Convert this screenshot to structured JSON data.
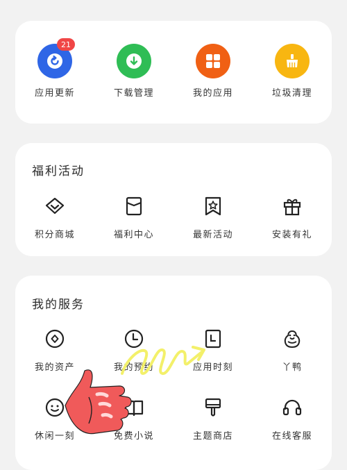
{
  "colors": {
    "background": "#f2f2f2",
    "card": "#ffffff",
    "update": "#2f66e6",
    "download": "#2fbd55",
    "my_apps": "#f06014",
    "cleanup": "#f8b611",
    "badge": "#f04646",
    "hand": "#f05a5a",
    "scribble": "#f3f06a"
  },
  "top": {
    "items": [
      {
        "label": "应用更新",
        "icon": "refresh-icon",
        "badge": "21"
      },
      {
        "label": "下载管理",
        "icon": "download-icon"
      },
      {
        "label": "我的应用",
        "icon": "apps-grid-icon"
      },
      {
        "label": "垃圾清理",
        "icon": "broom-icon"
      }
    ]
  },
  "welfare": {
    "title": "福利活动",
    "items": [
      {
        "label": "积分商城",
        "icon": "diamond-icon"
      },
      {
        "label": "福利中心",
        "icon": "envelope-icon"
      },
      {
        "label": "最新活动",
        "icon": "star-bookmark-icon"
      },
      {
        "label": "安装有礼",
        "icon": "gift-icon"
      }
    ]
  },
  "service": {
    "title": "我的服务",
    "rows": [
      [
        {
          "label": "我的资产",
          "icon": "coin-icon"
        },
        {
          "label": "我的预约",
          "icon": "clock-icon"
        },
        {
          "label": "应用时刻",
          "icon": "calendar-icon"
        },
        {
          "label": "丫鸭",
          "icon": "duck-icon"
        }
      ],
      [
        {
          "label": "休闲一刻",
          "icon": "smiley-icon"
        },
        {
          "label": "免费小说",
          "icon": "book-icon"
        },
        {
          "label": "主题商店",
          "icon": "paint-brush-icon"
        },
        {
          "label": "在线客服",
          "icon": "headset-icon"
        }
      ]
    ]
  }
}
